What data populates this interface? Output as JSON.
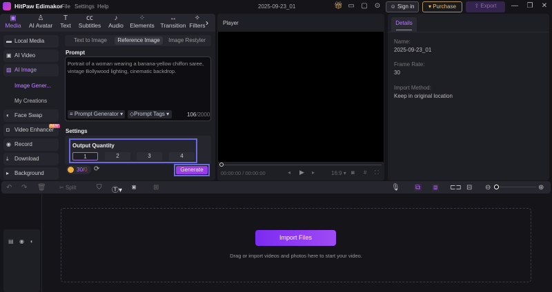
{
  "app": {
    "name": "HitPaw Edimakor",
    "menu": [
      "File",
      "Settings",
      "Help"
    ],
    "project": "2025-09-23_01",
    "sign_in": "Sign in",
    "purchase": "Purchase",
    "export": "Export"
  },
  "toptabs": [
    {
      "label": "Media",
      "icon": "media-icon"
    },
    {
      "label": "AI Avatar",
      "icon": "avatar-icon"
    },
    {
      "label": "Text",
      "icon": "text-icon"
    },
    {
      "label": "Subtitles",
      "icon": "subtitles-icon"
    },
    {
      "label": "Audio",
      "icon": "audio-icon"
    },
    {
      "label": "Elements",
      "icon": "elements-icon"
    },
    {
      "label": "Transition",
      "icon": "transition-icon"
    },
    {
      "label": "Filters",
      "icon": "filters-icon"
    }
  ],
  "sidebar": {
    "items": [
      "Local Media",
      "AI Video",
      "AI Image",
      "Face Swap",
      "Video Enhancer",
      "Record",
      "Download",
      "Background"
    ],
    "sub": [
      "Image Gener...",
      "My Creations"
    ],
    "new_badge": "NEW"
  },
  "ai_image": {
    "subtabs": [
      "Text to Image",
      "Reference Image",
      "Image Restyler"
    ],
    "prompt_label": "Prompt",
    "prompt_text": "Portrait of a woman wearing a banana-yellow chiffon saree, vintage Bollywood lighting, cinematic backdrop.",
    "prompt_generator": "Prompt Generator",
    "prompt_tags": "Prompt Tags",
    "count": "106",
    "max": "/2000",
    "settings": "Settings",
    "output_quantity": "Output Quantity",
    "quantities": [
      "1",
      "2",
      "3",
      "4"
    ],
    "credits": "30",
    "credits_used": "0",
    "generate": "Generate"
  },
  "player": {
    "title": "Player",
    "time": "00:00:00",
    "duration": "/ 00:00:00",
    "ratio": "16:9"
  },
  "details": {
    "tab": "Details",
    "name_label": "Name:",
    "name": "2025-09-23_01",
    "fps_label": "Frame Rate:",
    "fps": "30",
    "import_label": "Import Method:",
    "import": "Keep in original location"
  },
  "timeline": {
    "split": "Split",
    "import_files": "Import Files",
    "hint": "Drag or import videos and photos here to start your video."
  },
  "colors": {
    "accent": "#a04af5",
    "bg": "#141419"
  }
}
